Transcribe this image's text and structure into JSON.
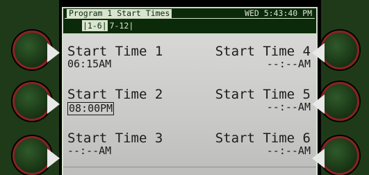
{
  "header": {
    "title": "Program 1 Start Times",
    "clock": "WED 5:43:40 PM"
  },
  "range_tabs": {
    "active": "|1-6|",
    "other": "7-12|"
  },
  "start_times": [
    {
      "label": "Start Time 1",
      "value": "06:15AM"
    },
    {
      "label": "Start Time 2",
      "value": "08:00PM"
    },
    {
      "label": "Start Time 3",
      "value": "--:--AM"
    },
    {
      "label": "Start Time 4",
      "value": "--:--AM"
    },
    {
      "label": "Start Time 5",
      "value": "--:--AM"
    },
    {
      "label": "Start Time 6",
      "value": "--:--AM"
    }
  ],
  "selected_slot": "Start Time 2",
  "colors": {
    "bezel": "#1f3a18",
    "lcd": "#d7d7d5",
    "knob_ring": "#8a2222"
  },
  "icons": {
    "side_button": "round-knob-with-arrow-icon"
  }
}
